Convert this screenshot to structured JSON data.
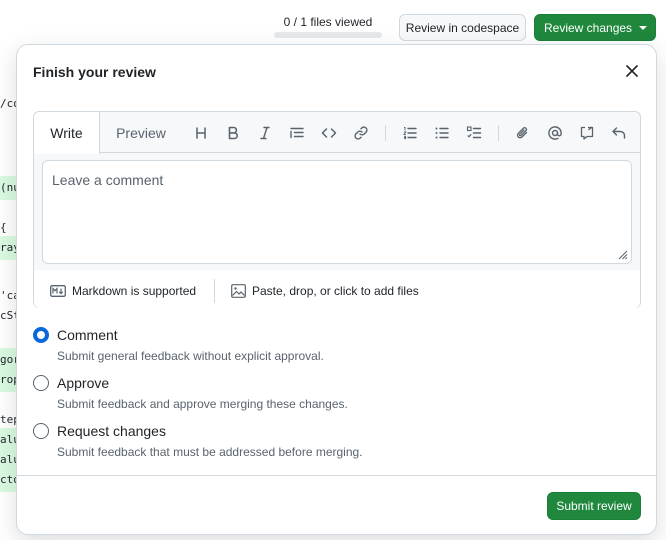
{
  "topbar": {
    "files_viewed": "0 / 1 files viewed",
    "progress_fraction": 0.0,
    "codespace_button": "Review in codespace",
    "review_button": "Review changes"
  },
  "background_code": [
    {
      "text": "/co",
      "bg": "#ffffff"
    },
    {
      "text": "(nu",
      "bg": "#dafbe1"
    },
    {
      "text": "{",
      "bg": "#ffffff"
    },
    {
      "text": "ray",
      "bg": "#dafbe1"
    },
    {
      "text": "'ca",
      "bg": "#ffffff"
    },
    {
      "text": "cSt",
      "bg": "#ffffff"
    },
    {
      "text": "gor",
      "bg": "#dafbe1"
    },
    {
      "text": "rop",
      "bg": "#dafbe1"
    },
    {
      "text": "tep",
      "bg": "#ffffff"
    },
    {
      "text": "alu",
      "bg": "#dafbe1"
    },
    {
      "text": "alu",
      "bg": "#dafbe1"
    },
    {
      "text": "cto",
      "bg": "#dafbe1"
    }
  ],
  "modal": {
    "title": "Finish your review",
    "tabs": {
      "write": "Write",
      "preview": "Preview"
    },
    "comment_placeholder": "Leave a comment",
    "markdown_note": "Markdown is supported",
    "attach_note": "Paste, drop, or click to add files",
    "options": [
      {
        "label": "Comment",
        "description": "Submit general feedback without explicit approval.",
        "checked": true
      },
      {
        "label": "Approve",
        "description": "Submit feedback and approve merging these changes.",
        "checked": false
      },
      {
        "label": "Request changes",
        "description": "Submit feedback that must be addressed before merging.",
        "checked": false
      }
    ],
    "submit_label": "Submit review"
  },
  "colors": {
    "accent": "#0969da",
    "primary_green": "#1f883d",
    "muted_text": "#59636e"
  },
  "toolbar_icons": [
    "heading-icon",
    "bold-icon",
    "italic-icon",
    "quote-icon",
    "code-icon",
    "link-icon",
    "ordered-list-icon",
    "unordered-list-icon",
    "task-list-icon",
    "attach-icon",
    "mention-icon",
    "reference-icon",
    "undo-icon"
  ]
}
